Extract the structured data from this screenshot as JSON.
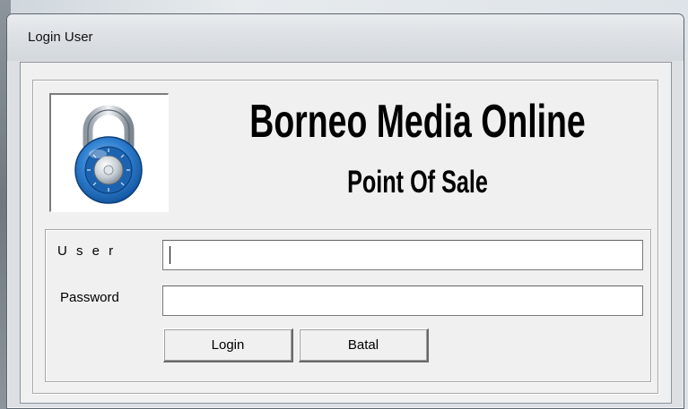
{
  "window": {
    "title": "Login User"
  },
  "brand": {
    "title": "Borneo Media Online",
    "subtitle": "Point Of Sale",
    "logo_icon": "padlock-icon"
  },
  "form": {
    "user_label": "U s e r",
    "user_value": "",
    "password_label": "Password",
    "password_value": ""
  },
  "buttons": {
    "login_label": "Login",
    "cancel_label": "Batal"
  },
  "colors": {
    "lock_blue": "#2f7fd0",
    "window_bg": "#f0f0f0"
  }
}
